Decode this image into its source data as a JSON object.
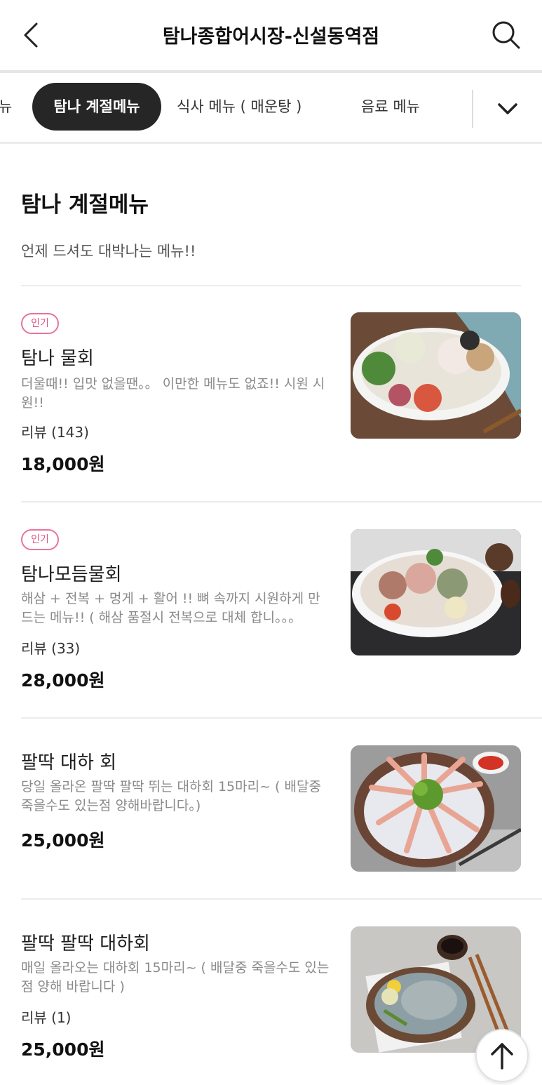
{
  "header": {
    "title": "탐나종합어시장-신설동역점",
    "back_icon": "chevron-left-icon",
    "search_icon": "search-icon"
  },
  "tabs": {
    "partial_label": "뉴",
    "items": [
      {
        "label": "탐나 계절메뉴",
        "active": true
      },
      {
        "label": "식사 메뉴 ( 매운탕 )",
        "active": false
      },
      {
        "label": "음료 메뉴",
        "active": false
      }
    ],
    "more_icon": "chevron-down-icon"
  },
  "section": {
    "title": "탐나 계절메뉴",
    "description": "언제 드셔도 대박나는 메뉴!!"
  },
  "menu_items": [
    {
      "badge": "인기",
      "name": "탐나 물회",
      "description": "더울때!! 입맛 없을땐。。 이만한 메뉴도 없죠!! 시원 시원!!",
      "review": "리뷰 (143)",
      "price": "18,000원"
    },
    {
      "badge": "인기",
      "name": "탐나모듬물회",
      "description": "해삼 + 전복 + 멍게 + 활어 !! 뼈 속까지 시원하게 만드는 메뉴!! ( 해삼 품절시 전복으로 대체 합니。。。",
      "review": "리뷰 (33)",
      "price": "28,000원"
    },
    {
      "badge": "",
      "name": "팔딱 대하 회",
      "description": "당일 올라온 팔딱 팔딱 뛰는 대하회 15마리~ ( 배달중 죽을수도 있는점 양해바랍니다。)",
      "review": "",
      "price": "25,000원"
    },
    {
      "badge": "",
      "name": "팔딱 팔딱 대하회",
      "description": "매일 올라오는 대하회 15마리~ ( 배달중 죽을수도 있는 점 양해 바랍니다 )",
      "review": "리뷰 (1)",
      "price": "25,000원"
    }
  ],
  "scroll_top_icon": "arrow-up-icon",
  "colors": {
    "active_tab_bg": "#262626",
    "badge_pink": "#e05584",
    "divider": "#ececec"
  }
}
